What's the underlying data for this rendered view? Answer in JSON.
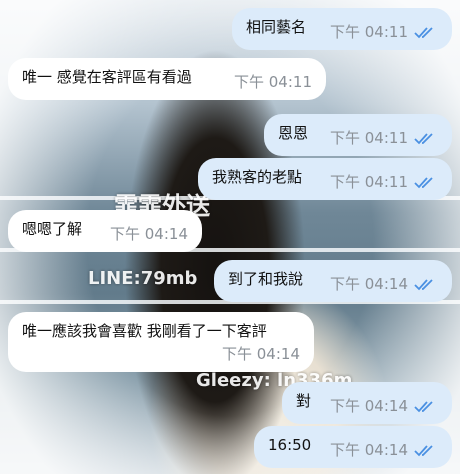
{
  "background": {
    "watermark_name": "霏霏外送",
    "watermark_line": "LINE:79mb",
    "watermark_gleezy": "Gleezy: ln336m"
  },
  "colors": {
    "incoming_bubble": "#ffffff",
    "outgoing_bubble": "#dcebfa",
    "time_text": "#8a9097",
    "read_check": "#4a90e2"
  },
  "messages": [
    {
      "side": "out",
      "text": "相同藝名",
      "time": "下午 04:11",
      "read": true
    },
    {
      "side": "in",
      "text": "唯一 感覺在客評區有看過",
      "time": "下午 04:11"
    },
    {
      "side": "out",
      "text": "恩恩",
      "time": "下午 04:11",
      "read": true
    },
    {
      "side": "out",
      "text": "我熟客的老點",
      "time": "下午 04:11",
      "read": true
    },
    {
      "side": "in",
      "text": "嗯嗯了解",
      "time": "下午 04:14"
    },
    {
      "side": "out",
      "text": "到了和我說",
      "time": "下午 04:14",
      "read": true
    },
    {
      "side": "in",
      "text": "唯一應該我會喜歡 我剛看了一下客評",
      "time": "下午 04:14"
    },
    {
      "side": "out",
      "text": "對",
      "time": "下午 04:14",
      "read": true
    },
    {
      "side": "out",
      "text": "16:50",
      "time": "下午 04:14",
      "read": true
    }
  ],
  "icons": {
    "read_receipt": "double-check-icon"
  }
}
